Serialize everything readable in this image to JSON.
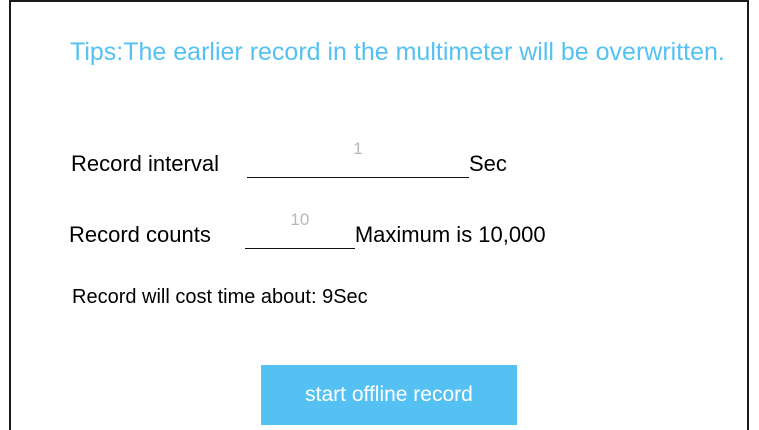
{
  "tips": "Tips:The earlier record in the multimeter will be overwritten.",
  "interval": {
    "label": "Record interval",
    "value": "1",
    "unit": "Sec"
  },
  "counts": {
    "label": "Record counts",
    "value": "10",
    "note": "Maximum is 10,000"
  },
  "estimate": "Record will cost time about: 9Sec",
  "start_button": "start offline record",
  "colors": {
    "accent": "#55c1f2",
    "input_text": "#b8b8b8",
    "text": "#000000"
  }
}
